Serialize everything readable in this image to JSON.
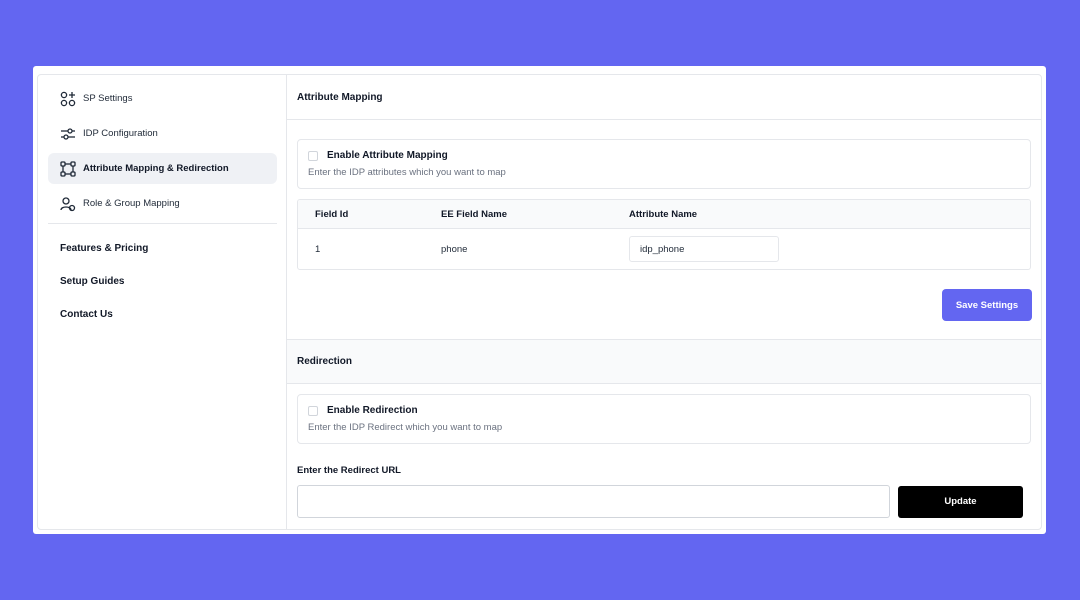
{
  "sidebar": {
    "items": [
      {
        "label": "SP Settings",
        "icon": "grid-plus-icon"
      },
      {
        "label": "IDP Configuration",
        "icon": "sliders-icon"
      },
      {
        "label": "Attribute Mapping & Redirection",
        "icon": "nodes-icon",
        "active": true
      },
      {
        "label": "Role & Group Mapping",
        "icon": "users-icon"
      }
    ],
    "links": [
      "Features & Pricing",
      "Setup Guides",
      "Contact Us"
    ]
  },
  "attribute_mapping": {
    "title": "Attribute Mapping",
    "enable_label": "Enable Attribute Mapping",
    "description": "Enter the IDP attributes which you want to map",
    "columns": [
      "Field Id",
      "EE Field Name",
      "Attribute Name"
    ],
    "rows": [
      {
        "field_id": "1",
        "field_name": "phone",
        "attribute_value": "idp_phone"
      }
    ],
    "save_label": "Save Settings"
  },
  "redirection": {
    "title": "Redirection",
    "enable_label": "Enable Redirection",
    "description": "Enter the IDP Redirect which you want to map",
    "url_label": "Enter the Redirect URL",
    "url_value": "",
    "update_label": "Update"
  },
  "colors": {
    "background": "#6366f1",
    "primary_button": "#6366f1",
    "update_button": "#000000"
  }
}
